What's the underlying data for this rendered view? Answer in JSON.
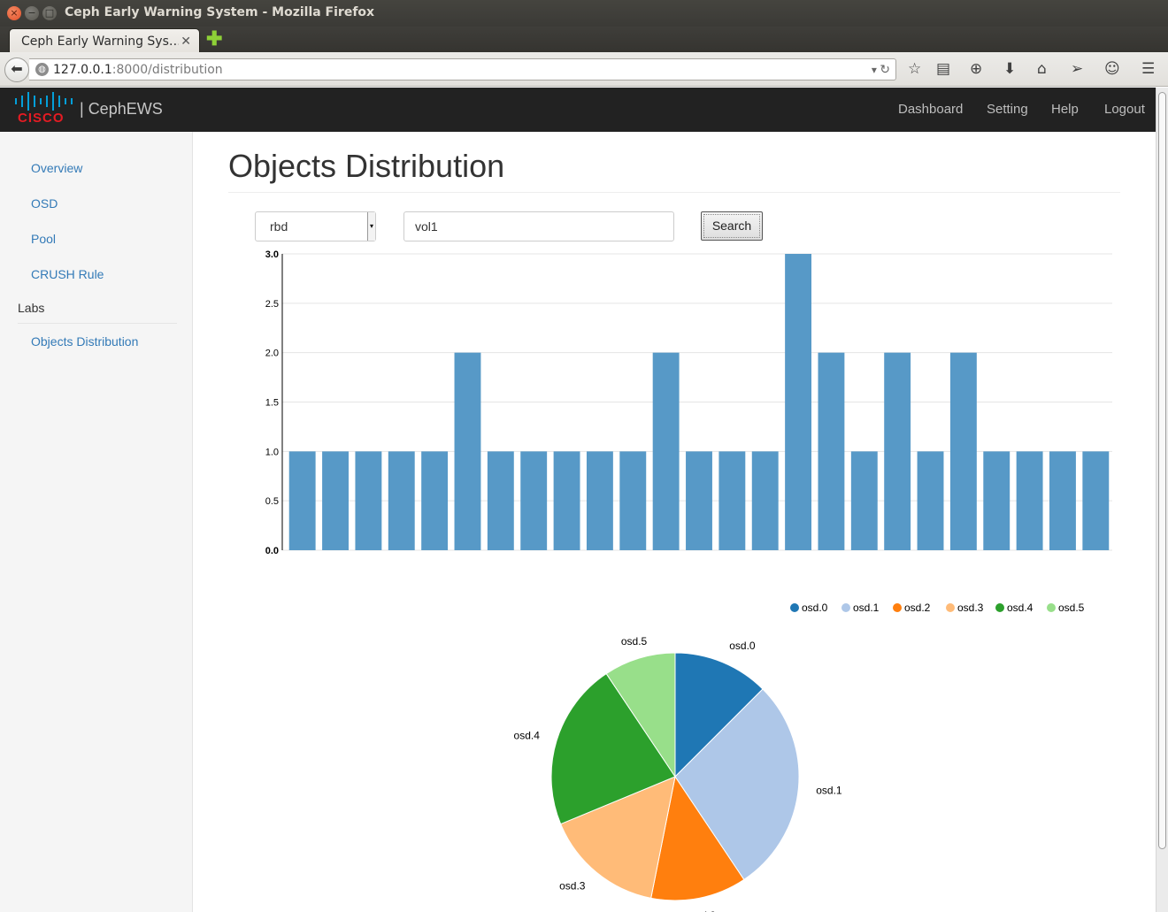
{
  "window": {
    "title": "Ceph Early Warning System - Mozilla Firefox"
  },
  "browser": {
    "tab_title": "Ceph Early Warning System",
    "tab_title_display": "Ceph Early Warning Sys…",
    "url_host": "127.0.0.1",
    "url_rest": ":8000/distribution"
  },
  "app": {
    "brand": "CephEWS",
    "logo_text": "CISCO",
    "nav": [
      "Dashboard",
      "Setting",
      "Help",
      "Logout"
    ]
  },
  "sidebar": {
    "items": [
      {
        "label": "Overview",
        "type": "link"
      },
      {
        "label": "OSD",
        "type": "link"
      },
      {
        "label": "Pool",
        "type": "link"
      },
      {
        "label": "CRUSH Rule",
        "type": "link"
      },
      {
        "label": "Labs",
        "type": "header"
      },
      {
        "label": "Objects Distribution",
        "type": "link"
      }
    ]
  },
  "main": {
    "title": "Objects Distribution",
    "pool_select_value": "rbd",
    "image_input_value": "vol1",
    "search_label": "Search"
  },
  "colors": {
    "bar": "#5799c7",
    "osd": [
      "#1f77b4",
      "#aec7e8",
      "#ff7f0e",
      "#ffbb78",
      "#2ca02c",
      "#98df8a"
    ]
  },
  "chart_data": [
    {
      "type": "bar",
      "values": [
        1,
        1,
        1,
        1,
        1,
        2,
        1,
        1,
        1,
        1,
        1,
        2,
        1,
        1,
        1,
        3,
        2,
        1,
        2,
        1,
        2,
        1,
        1,
        1,
        1
      ],
      "ylim": [
        0,
        3
      ],
      "yticks": [
        "0.0",
        "0.5",
        "1.0",
        "1.5",
        "2.0",
        "2.5",
        "3.0"
      ],
      "grid": true
    },
    {
      "type": "pie",
      "labels": [
        "osd.0",
        "osd.1",
        "osd.2",
        "osd.3",
        "osd.4",
        "osd.5"
      ],
      "values": [
        4,
        9,
        4,
        5,
        7,
        3
      ],
      "legend": "top-right"
    }
  ]
}
